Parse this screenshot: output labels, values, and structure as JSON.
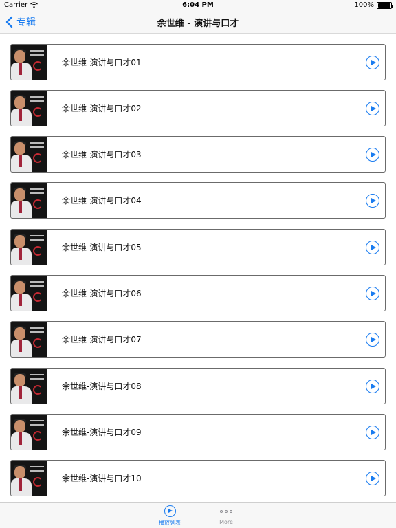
{
  "status_bar": {
    "carrier": "Carrier",
    "time": "6:04 PM",
    "battery": "100%",
    "wifi_icon": "wifi-icon",
    "battery_icon": "battery-icon"
  },
  "nav": {
    "back_label": "专辑",
    "title": "余世维 - 演讲与口才"
  },
  "list": {
    "items": [
      {
        "title": "余世维-演讲与口才01"
      },
      {
        "title": "余世维-演讲与口才02"
      },
      {
        "title": "余世维-演讲与口才03"
      },
      {
        "title": "余世维-演讲与口才04"
      },
      {
        "title": "余世维-演讲与口才05"
      },
      {
        "title": "余世维-演讲与口才06"
      },
      {
        "title": "余世维-演讲与口才07"
      },
      {
        "title": "余世维-演讲与口才08"
      },
      {
        "title": "余世维-演讲与口才09"
      },
      {
        "title": "余世维-演讲与口才10"
      }
    ]
  },
  "tab_bar": {
    "tabs": [
      {
        "label": "播放列表",
        "icon": "play-circle-icon",
        "selected": true
      },
      {
        "label": "More",
        "icon": "more-dots-icon",
        "selected": false
      }
    ]
  },
  "colors": {
    "accent": "#1a7cf0",
    "bar_background": "#f7f7f7",
    "inactive_tab": "#8e8e93"
  }
}
